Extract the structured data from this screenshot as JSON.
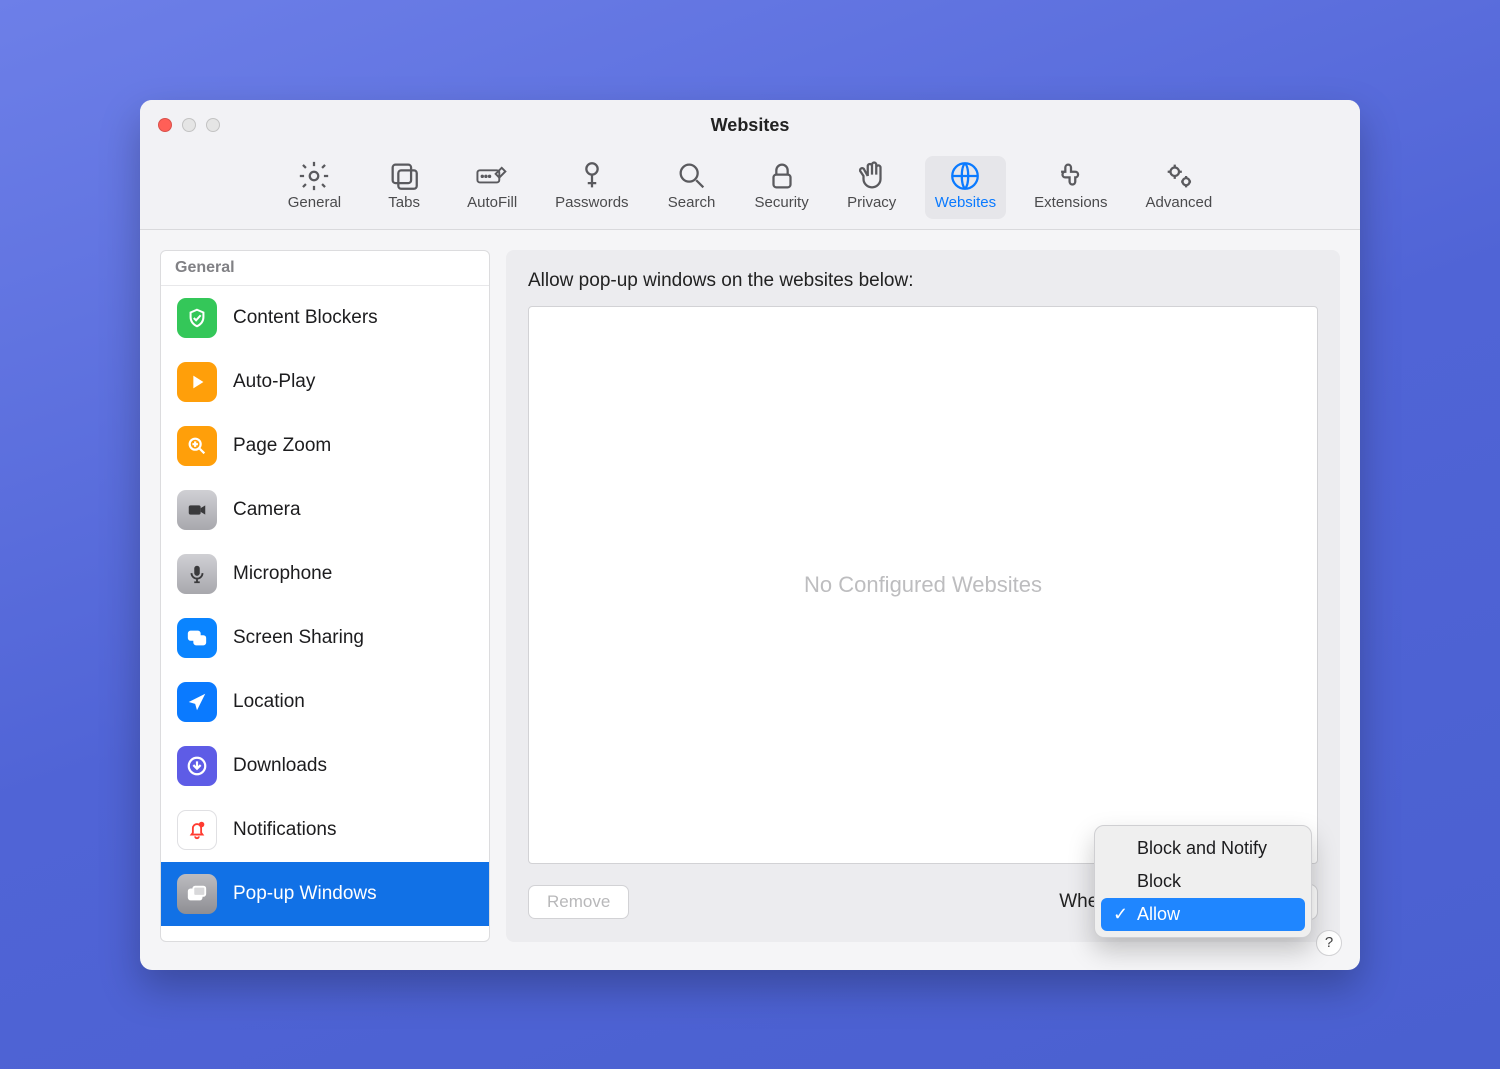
{
  "window": {
    "title": "Websites"
  },
  "toolbar": {
    "tabs": [
      {
        "label": "General",
        "active": false
      },
      {
        "label": "Tabs",
        "active": false
      },
      {
        "label": "AutoFill",
        "active": false
      },
      {
        "label": "Passwords",
        "active": false
      },
      {
        "label": "Search",
        "active": false
      },
      {
        "label": "Security",
        "active": false
      },
      {
        "label": "Privacy",
        "active": false
      },
      {
        "label": "Websites",
        "active": true
      },
      {
        "label": "Extensions",
        "active": false
      },
      {
        "label": "Advanced",
        "active": false
      }
    ]
  },
  "sidebar": {
    "section_label": "General",
    "items": [
      {
        "label": "Content Blockers",
        "icon": "shield-check",
        "color": "#34c759",
        "selected": false
      },
      {
        "label": "Auto-Play",
        "icon": "play",
        "color": "#ff9f0a",
        "selected": false
      },
      {
        "label": "Page Zoom",
        "icon": "zoom",
        "color": "#ff9f0a",
        "selected": false
      },
      {
        "label": "Camera",
        "icon": "camera",
        "color": "#8e8e93",
        "selected": false
      },
      {
        "label": "Microphone",
        "icon": "mic",
        "color": "#8e8e93",
        "selected": false
      },
      {
        "label": "Screen Sharing",
        "icon": "screens",
        "color": "#0a84ff",
        "selected": false
      },
      {
        "label": "Location",
        "icon": "arrow",
        "color": "#0a7aff",
        "selected": false
      },
      {
        "label": "Downloads",
        "icon": "download",
        "color": "#5e5ce6",
        "selected": false
      },
      {
        "label": "Notifications",
        "icon": "bell",
        "color": "#ffffff",
        "selected": false
      },
      {
        "label": "Pop-up Windows",
        "icon": "popup",
        "color": "#8e8e93",
        "selected": true
      }
    ]
  },
  "main": {
    "heading": "Allow pop-up windows on the websites below:",
    "empty_text": "No Configured Websites",
    "remove_button": "Remove",
    "footer_label": "When visiting other websites",
    "dropdown": {
      "options": [
        {
          "label": "Block and Notify",
          "selected": false
        },
        {
          "label": "Block",
          "selected": false
        },
        {
          "label": "Allow",
          "selected": true
        }
      ]
    }
  },
  "help": "?"
}
